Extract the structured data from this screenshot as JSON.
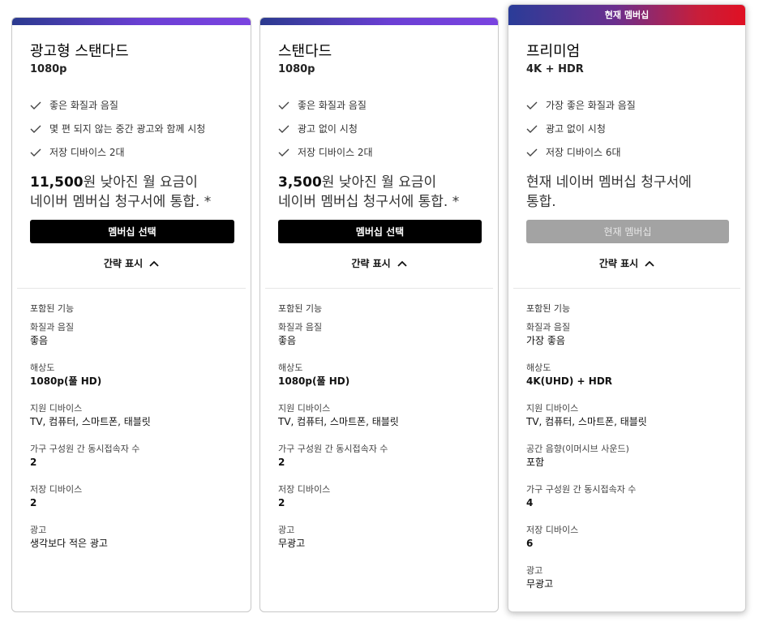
{
  "plans": [
    {
      "title": "광고형 스탠다드",
      "resolution": "1080p",
      "features": [
        "좋은 화질과 음질",
        "몇 편 되지 않는 중간 광고와 함께 시청",
        "저장 디바이스 2대"
      ],
      "price_amount": "11,500",
      "price_text_1": "원 낮아진 월 요금이",
      "price_text_2": "네이버 멤버십 청구서에 통합. *",
      "button_label": "멤버십 선택",
      "collapse_label": "간략 표시",
      "details_heading": "포함된 기능",
      "details": [
        {
          "label": "화질과 음질",
          "value": "좋음"
        },
        {
          "label": "해상도",
          "value": "1080p(풀 HD)"
        },
        {
          "label": "지원 디바이스",
          "value": "TV, 컴퓨터, 스마트폰, 태블릿"
        },
        {
          "label": "가구 구성원 간 동시접속자 수",
          "value": "2"
        },
        {
          "label": "저장 디바이스",
          "value": "2"
        },
        {
          "label": "광고",
          "value": "생각보다 적은 광고"
        }
      ]
    },
    {
      "title": "스탠다드",
      "resolution": "1080p",
      "features": [
        "좋은 화질과 음질",
        "광고 없이 시청",
        "저장 디바이스 2대"
      ],
      "price_amount": "3,500",
      "price_text_1": "원 낮아진 월 요금이",
      "price_text_2": "네이버 멤버십 청구서에 통합. *",
      "button_label": "멤버십 선택",
      "collapse_label": "간략 표시",
      "details_heading": "포함된 기능",
      "details": [
        {
          "label": "화질과 음질",
          "value": "좋음"
        },
        {
          "label": "해상도",
          "value": "1080p(풀 HD)"
        },
        {
          "label": "지원 디바이스",
          "value": "TV, 컴퓨터, 스마트폰, 태블릿"
        },
        {
          "label": "가구 구성원 간 동시접속자 수",
          "value": "2"
        },
        {
          "label": "저장 디바이스",
          "value": "2"
        },
        {
          "label": "광고",
          "value": "무광고"
        }
      ]
    },
    {
      "badge": "현재 멤버십",
      "title": "프리미엄",
      "resolution": "4K + HDR",
      "features": [
        "가장 좋은 화질과 음질",
        "광고 없이 시청",
        "저장 디바이스 6대"
      ],
      "price_text_1": "현재 네이버 멤버십 청구서에",
      "price_text_2": "통합.",
      "button_label": "현재 멤버십",
      "collapse_label": "간략 표시",
      "details_heading": "포함된 기능",
      "details": [
        {
          "label": "화질과 음질",
          "value": "가장 좋음"
        },
        {
          "label": "해상도",
          "value": "4K(UHD) + HDR"
        },
        {
          "label": "지원 디바이스",
          "value": "TV, 컴퓨터, 스마트폰, 태블릿"
        },
        {
          "label": "공간 음향(이머시브 사운드)",
          "value": "포함"
        },
        {
          "label": "가구 구성원 간 동시접속자 수",
          "value": "4"
        },
        {
          "label": "저장 디바이스",
          "value": "6"
        },
        {
          "label": "광고",
          "value": "무광고"
        }
      ]
    }
  ]
}
